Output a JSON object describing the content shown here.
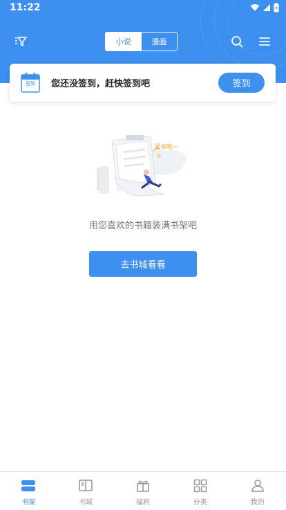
{
  "status_bar": {
    "time": "11:22"
  },
  "header": {
    "tabs": [
      {
        "label": "小说",
        "active": true
      },
      {
        "label": "漫画",
        "active": false
      }
    ],
    "icons": {
      "filter": "filter-icon",
      "search": "search-icon",
      "menu": "menu-icon"
    }
  },
  "signin": {
    "calendar_label": "签到",
    "message": "您还没签到，赶快签到吧",
    "button_label": "签到"
  },
  "empty_state": {
    "bubble_text": "没书啦~",
    "message": "用您喜欢的书籍装满书架吧",
    "button_label": "去书城看看"
  },
  "bottom_nav": [
    {
      "label": "书架",
      "icon": "bookshelf-icon",
      "active": true
    },
    {
      "label": "书城",
      "icon": "book-open-icon",
      "active": false
    },
    {
      "label": "福利",
      "icon": "gift-icon",
      "active": false
    },
    {
      "label": "分类",
      "icon": "grid-icon",
      "active": false
    },
    {
      "label": "我的",
      "icon": "user-icon",
      "active": false
    }
  ],
  "colors": {
    "primary": "#3d8ff0",
    "inactive": "#999999",
    "accent": "#f5a623"
  }
}
